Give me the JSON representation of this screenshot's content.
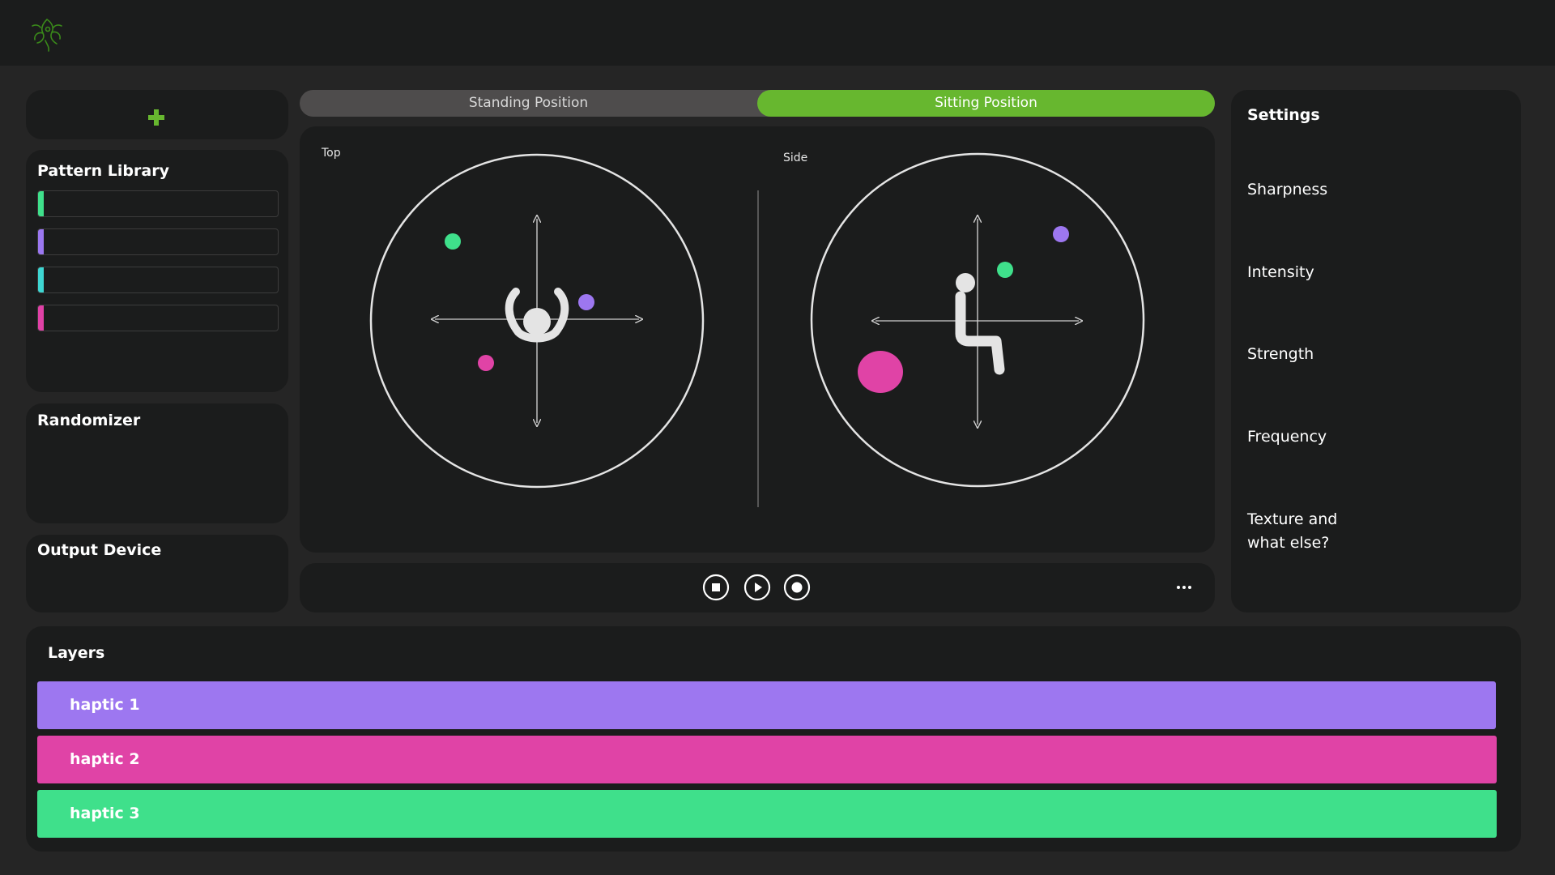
{
  "sidebar": {
    "add_button": "+",
    "pattern_library": {
      "title": "Pattern Library",
      "items": [
        {
          "color": "#3fe08b"
        },
        {
          "color": "#9b77f0"
        },
        {
          "color": "#3ed6d2"
        },
        {
          "color": "#e041a6"
        }
      ]
    },
    "randomizer": {
      "title": "Randomizer"
    },
    "output_device": {
      "title": "Output Device"
    }
  },
  "position_toggle": {
    "options": [
      "Standing Position",
      "Sitting Position"
    ],
    "selected": "Sitting Position"
  },
  "visualizer": {
    "top_label": "Top",
    "side_label": "Side"
  },
  "playback": {
    "buttons": [
      "stop-icon",
      "play-icon",
      "record-icon"
    ],
    "more": "more-icon"
  },
  "settings": {
    "title": "Settings",
    "items": [
      "Sharpness",
      "Intensity",
      "Strength",
      "Frequency",
      "Texture and",
      "what else?"
    ]
  },
  "layers": {
    "title": "Layers",
    "items": [
      {
        "label": "haptic 1",
        "color": "#9d77f0"
      },
      {
        "label": "haptic 2",
        "color": "#e043a6"
      },
      {
        "label": "haptic 3",
        "color": "#3fe08b"
      }
    ]
  },
  "colors": {
    "accent_green": "#67b72f",
    "panel_bg": "#1b1c1c",
    "page_bg": "#252525"
  }
}
